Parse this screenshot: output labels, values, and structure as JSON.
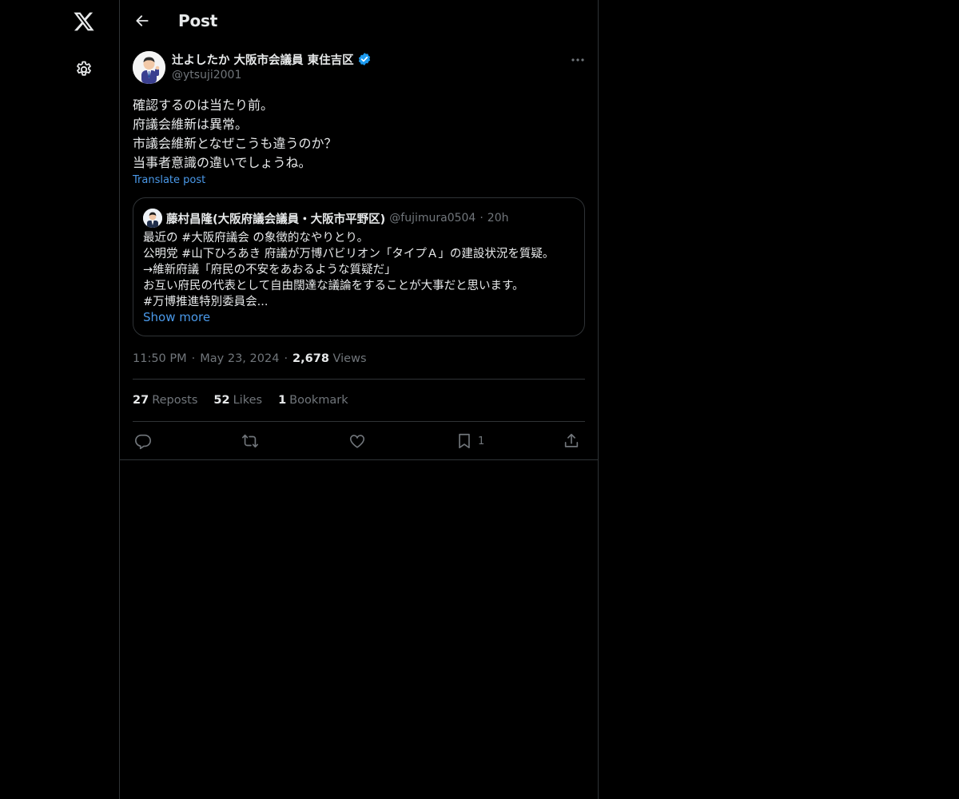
{
  "nav": {
    "items": [
      {
        "icon": "x-logo-icon"
      },
      {
        "icon": "gear-icon"
      }
    ]
  },
  "header": {
    "title": "Post",
    "back_icon": "arrow-left-icon"
  },
  "post": {
    "author": {
      "name": "辻よしたか 大阪市会議員 東住吉区",
      "handle": "@ytsuji2001",
      "verified": true,
      "verified_color": "#1d9bf0"
    },
    "lines": [
      "確認するのは当たり前。",
      "府議会維新は異常。",
      "市議会維新となぜこうも違うのか？",
      "当事者意識の違いでしょうね。"
    ],
    "translate_label": "Translate post",
    "quote": {
      "name": "藤村昌隆(大阪府議会議員・大阪市平野区)",
      "handle": "@fujimura0504",
      "separator": "·",
      "time": "20h",
      "lines": [
        "最近の #大阪府議会 の象徴的なやりとり。",
        "公明党 #山下ひろあき 府議が万博パビリオン「タイプＡ」の建設状況を質疑。",
        "→維新府議「府民の不安をあおるような質疑だ」",
        "お互い府民の代表として自由闊達な議論をすることが大事だと思います。",
        " #万博推進特別委員会..."
      ],
      "show_more": "Show more"
    },
    "meta": {
      "time": "11:50 PM",
      "separator": "·",
      "date": "May 23, 2024",
      "views_count": "2,678",
      "views_label": "Views"
    },
    "stats": {
      "reposts_count": "27",
      "reposts_label": "Reposts",
      "likes_count": "52",
      "likes_label": "Likes",
      "bookmarks_count": "1",
      "bookmarks_label": "Bookmark"
    },
    "actions": {
      "bookmark_count": "1"
    }
  },
  "colors": {
    "background": "#000000",
    "text": "#e7e9ea",
    "muted": "#71767b",
    "link": "#4a99e9",
    "border": "#2f3336"
  }
}
